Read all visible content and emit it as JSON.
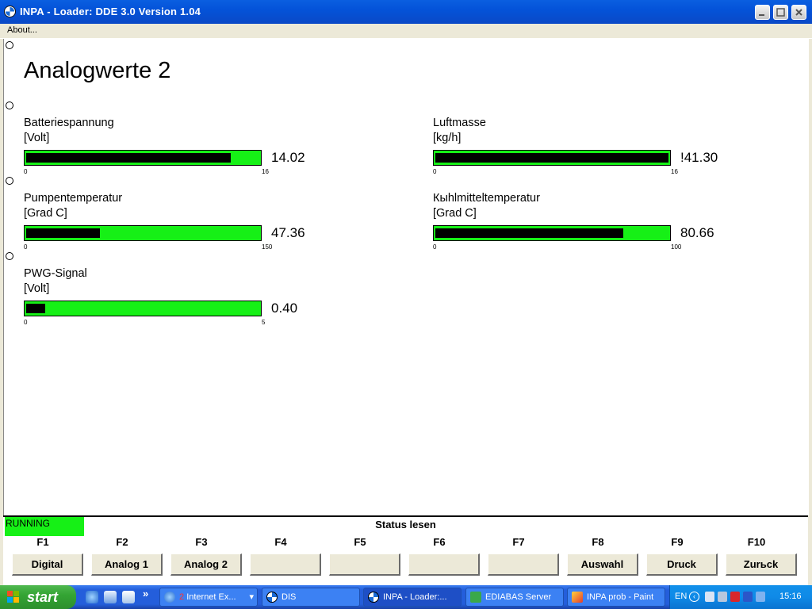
{
  "window": {
    "title": "INPA - Loader:  DDE 3.0 Version 1.04",
    "menu": [
      "About..."
    ]
  },
  "screen": {
    "heading": "Analogwerte 2",
    "gauges": [
      {
        "name": "Batteriespannung",
        "unit": "[Volt]",
        "value": "14.02",
        "min": "0",
        "max": "16",
        "level": 0.876
      },
      {
        "name": "Luftmasse",
        "unit": "[kg/h]",
        "value": "!41.30",
        "min": "0",
        "max": "16",
        "level": 1.0
      },
      {
        "name": "Pumpentemperatur",
        "unit": "[Grad C]",
        "value": "47.36",
        "min": "0",
        "max": "150",
        "level": 0.316
      },
      {
        "name": "Кыhlmitteltemperatur",
        "unit": "[Grad C]",
        "value": "80.66",
        "min": "0",
        "max": "100",
        "level": 0.807
      },
      {
        "name": "PWG-Signal",
        "unit": "[Volt]",
        "value": "0.40",
        "min": "0",
        "max": "5",
        "level": 0.08
      }
    ]
  },
  "status": {
    "state": "RUNNING",
    "state_color": "#16f016",
    "text": "Status lesen"
  },
  "function_keys": [
    {
      "key": "F1",
      "label": "Digital"
    },
    {
      "key": "F2",
      "label": "Analog 1"
    },
    {
      "key": "F3",
      "label": "Analog 2"
    },
    {
      "key": "F4",
      "label": ""
    },
    {
      "key": "F5",
      "label": ""
    },
    {
      "key": "F6",
      "label": ""
    },
    {
      "key": "F7",
      "label": ""
    },
    {
      "key": "F8",
      "label": "Auswahl"
    },
    {
      "key": "F9",
      "label": "Druck"
    },
    {
      "key": "F10",
      "label": "Zurьck"
    }
  ],
  "taskbar": {
    "start_label": "start",
    "quicklaunch_icons": [
      "internet-explorer-icon",
      "outlook-express-icon",
      "notepad-icon"
    ],
    "overflow": "»",
    "tasks": [
      {
        "count": "2",
        "label": "Internet Ex...",
        "icon": "internet-explorer-icon"
      },
      {
        "label": "DIS",
        "icon": "bmw-icon"
      },
      {
        "label": "INPA - Loader:...",
        "icon": "bmw-icon"
      },
      {
        "label": "EDIABAS Server",
        "icon": "ediabas-icon"
      },
      {
        "label": "INPA prob - Paint",
        "icon": "paint-icon"
      }
    ],
    "language": "EN",
    "clock": "15:16"
  },
  "colors": {
    "bar_green": "#16f016",
    "titlebar_blue": "#0453d9",
    "taskbar_blue": "#245edb"
  }
}
